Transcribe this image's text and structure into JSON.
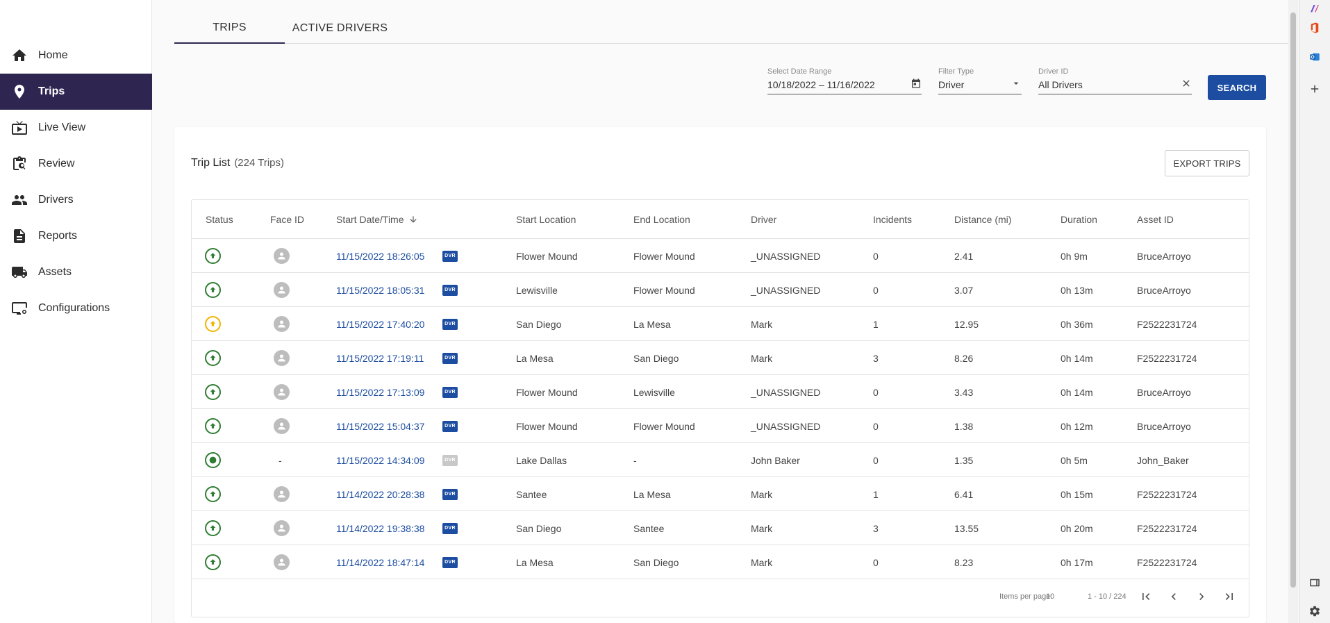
{
  "sidebar": {
    "items": [
      {
        "label": "Home",
        "icon": "home-icon"
      },
      {
        "label": "Trips",
        "icon": "location-pin-icon",
        "active": true
      },
      {
        "label": "Live View",
        "icon": "live-tv-icon"
      },
      {
        "label": "Review",
        "icon": "review-search-icon"
      },
      {
        "label": "Drivers",
        "icon": "people-icon"
      },
      {
        "label": "Reports",
        "icon": "document-icon"
      },
      {
        "label": "Assets",
        "icon": "truck-icon"
      },
      {
        "label": "Configurations",
        "icon": "settings-screen-icon"
      }
    ]
  },
  "tabs": [
    {
      "label": "TRIPS",
      "active": true
    },
    {
      "label": "ACTIVE DRIVERS",
      "active": false
    }
  ],
  "filters": {
    "date_range": {
      "label": "Select Date Range",
      "value": "10/18/2022 – 11/16/2022"
    },
    "filter_type": {
      "label": "Filter Type",
      "value": "Driver"
    },
    "driver_id": {
      "label": "Driver ID",
      "value": "All Drivers"
    },
    "search_label": "SEARCH"
  },
  "trip_list": {
    "title": "Trip List",
    "count": "(224 Trips)",
    "export_label": "EXPORT TRIPS",
    "columns": [
      "Status",
      "Face ID",
      "Start Date/Time",
      "Start Location",
      "End Location",
      "Driver",
      "Incidents",
      "Distance (mi)",
      "Duration",
      "Asset ID"
    ],
    "dvr_label": "DVR",
    "rows": [
      {
        "status": "ok",
        "face": "avatar",
        "start": "11/15/2022 18:26:05",
        "dvr": "on",
        "start_loc": "Flower Mound",
        "end_loc": "Flower Mound",
        "driver": "_UNASSIGNED",
        "incidents": "0",
        "distance": "2.41",
        "duration": "0h 9m",
        "asset": "BruceArroyo"
      },
      {
        "status": "ok",
        "face": "avatar",
        "start": "11/15/2022 18:05:31",
        "dvr": "on",
        "start_loc": "Lewisville",
        "end_loc": "Flower Mound",
        "driver": "_UNASSIGNED",
        "incidents": "0",
        "distance": "3.07",
        "duration": "0h 13m",
        "asset": "BruceArroyo"
      },
      {
        "status": "warn",
        "face": "avatar",
        "start": "11/15/2022 17:40:20",
        "dvr": "on",
        "start_loc": "San Diego",
        "end_loc": "La Mesa",
        "driver": "Mark",
        "incidents": "1",
        "distance": "12.95",
        "duration": "0h 36m",
        "asset": "F2522231724"
      },
      {
        "status": "ok",
        "face": "avatar",
        "start": "11/15/2022 17:19:11",
        "dvr": "on",
        "start_loc": "La Mesa",
        "end_loc": "San Diego",
        "driver": "Mark",
        "incidents": "3",
        "distance": "8.26",
        "duration": "0h 14m",
        "asset": "F2522231724"
      },
      {
        "status": "ok",
        "face": "avatar",
        "start": "11/15/2022 17:13:09",
        "dvr": "on",
        "start_loc": "Flower Mound",
        "end_loc": "Lewisville",
        "driver": "_UNASSIGNED",
        "incidents": "0",
        "distance": "3.43",
        "duration": "0h 14m",
        "asset": "BruceArroyo"
      },
      {
        "status": "ok",
        "face": "avatar",
        "start": "11/15/2022 15:04:37",
        "dvr": "on",
        "start_loc": "Flower Mound",
        "end_loc": "Flower Mound",
        "driver": "_UNASSIGNED",
        "incidents": "0",
        "distance": "1.38",
        "duration": "0h 12m",
        "asset": "BruceArroyo"
      },
      {
        "status": "done",
        "face": "-",
        "start": "11/15/2022 14:34:09",
        "dvr": "off",
        "start_loc": "Lake Dallas",
        "end_loc": "-",
        "driver": "John Baker",
        "incidents": "0",
        "distance": "1.35",
        "duration": "0h 5m",
        "asset": "John_Baker"
      },
      {
        "status": "ok",
        "face": "avatar",
        "start": "11/14/2022 20:28:38",
        "dvr": "on",
        "start_loc": "Santee",
        "end_loc": "La Mesa",
        "driver": "Mark",
        "incidents": "1",
        "distance": "6.41",
        "duration": "0h 15m",
        "asset": "F2522231724"
      },
      {
        "status": "ok",
        "face": "avatar",
        "start": "11/14/2022 19:38:38",
        "dvr": "on",
        "start_loc": "San Diego",
        "end_loc": "Santee",
        "driver": "Mark",
        "incidents": "3",
        "distance": "13.55",
        "duration": "0h 20m",
        "asset": "F2522231724"
      },
      {
        "status": "ok",
        "face": "avatar",
        "start": "11/14/2022 18:47:14",
        "dvr": "on",
        "start_loc": "La Mesa",
        "end_loc": "San Diego",
        "driver": "Mark",
        "incidents": "0",
        "distance": "8.23",
        "duration": "0h 17m",
        "asset": "F2522231724"
      }
    ]
  },
  "pagination": {
    "items_per_page_label": "Items per page:",
    "items_per_page": "10",
    "range": "1 - 10 / 224"
  },
  "colors": {
    "nav_active": "#2f2551",
    "primary": "#1c4da1",
    "status_ok": "#2e7d32",
    "status_warn": "#f2b400"
  }
}
